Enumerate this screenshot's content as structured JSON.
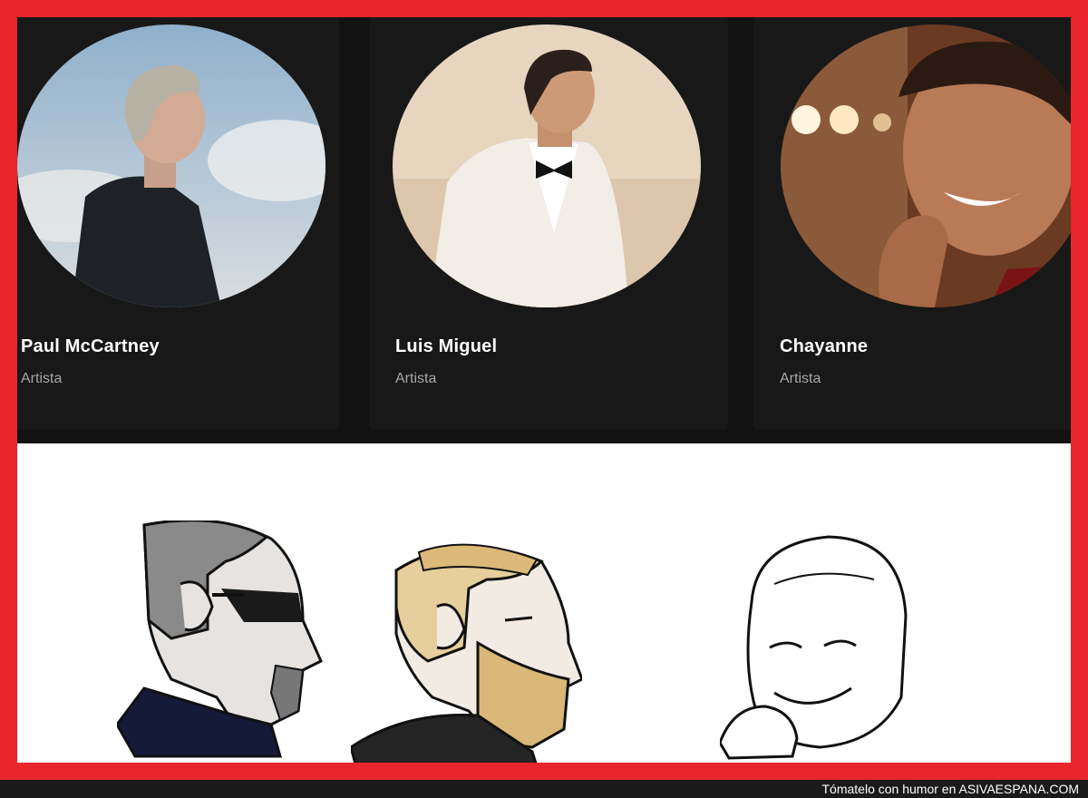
{
  "artists": [
    {
      "name": "Paul McCartney",
      "subtitle": "Artista"
    },
    {
      "name": "Luis Miguel",
      "subtitle": "Artista"
    },
    {
      "name": "Chayanne",
      "subtitle": "Artista"
    }
  ],
  "footer": {
    "caption": "Tómatelo con humor en",
    "brand": "ASIVAESPANA.COM"
  },
  "colors": {
    "frame": "#e8252a",
    "app_background": "#121212",
    "card_background": "#181818",
    "artist_name": "#ffffff",
    "subtitle": "#a7a7a7",
    "footer_background": "#1a1a1a"
  },
  "meme_characters": [
    "sunglasses-chad-icon",
    "blonde-bearded-chad-icon",
    "smiling-wojak-icon"
  ]
}
